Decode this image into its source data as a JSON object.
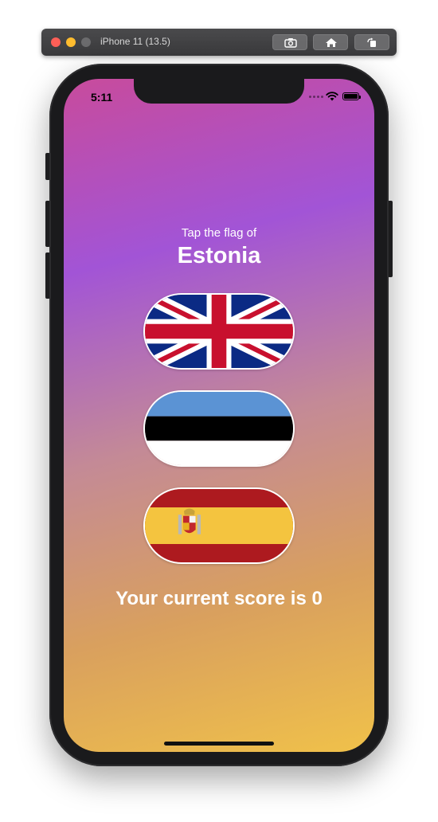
{
  "simulator": {
    "window_title": "iPhone 11 (13.5)",
    "buttons": [
      "screenshot-icon",
      "home-icon",
      "rotate-icon"
    ]
  },
  "status_bar": {
    "time": "5:11",
    "icons": [
      "cellular-icon",
      "wifi-icon",
      "battery-icon"
    ]
  },
  "game": {
    "prompt": "Tap the flag of",
    "country": "Estonia",
    "flags": [
      {
        "name": "United Kingdom",
        "icon": "uk-flag-icon"
      },
      {
        "name": "Estonia",
        "icon": "estonia-flag-icon"
      },
      {
        "name": "Spain",
        "icon": "spain-flag-icon"
      }
    ],
    "score_text": "Your current score is 0"
  },
  "colors": {
    "gradient_top": "#c84b9c",
    "gradient_mid": "#a254d6",
    "gradient_bottom": "#f0c14a",
    "text": "#ffffff"
  }
}
